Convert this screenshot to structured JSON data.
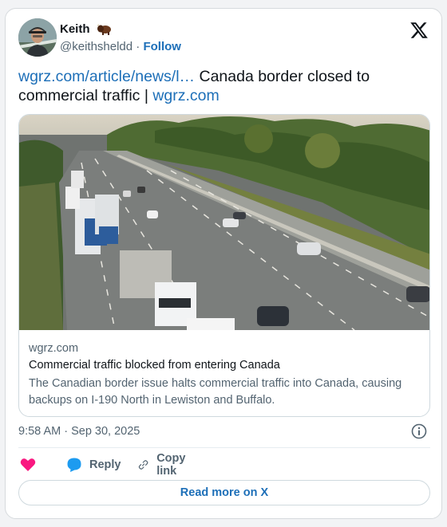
{
  "author": {
    "name": "Keith",
    "emoji_icon": "bison-icon",
    "handle": "@keithsheldd",
    "separator": "·",
    "follow_label": "Follow"
  },
  "tweet": {
    "link_text": "wgrz.com/article/news/l…",
    "text": " Canada border closed to commercial traffic | ",
    "link2_text": "wgrz.com"
  },
  "link_card": {
    "domain": "wgrz.com",
    "title": "Commercial traffic blocked from entering Canada",
    "description": "The Canadian border issue halts commercial traffic into Canada, causing backups on I-190 North in Lewiston and Buffalo."
  },
  "timestamp": "9:58 AM · Sep 30, 2025",
  "actions": {
    "reply_label": "Reply",
    "copy_link_label": "Copy link"
  },
  "read_more_label": "Read more on X",
  "colors": {
    "like": "#f91880",
    "reply": "#1d9bf0",
    "link": "#1d6fb8"
  }
}
